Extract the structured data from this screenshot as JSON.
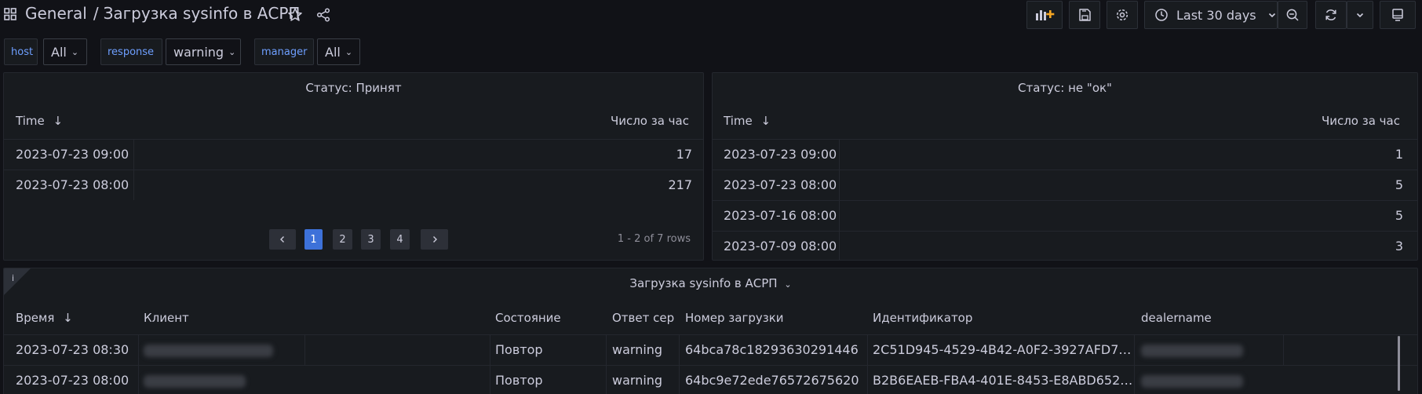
{
  "header": {
    "folder": "General",
    "separator": "/",
    "title": "Загрузка sysinfo в АСРП",
    "time_range": "Last 30 days"
  },
  "variables": [
    {
      "label": "host",
      "value": "All"
    },
    {
      "label": "response",
      "value": "warning"
    },
    {
      "label": "manager",
      "value": "All"
    }
  ],
  "panel_accepted": {
    "title": "Статус: Принят",
    "columns": [
      "Time",
      "Число за час"
    ],
    "rows": [
      [
        "2023-07-23 09:00",
        "17"
      ],
      [
        "2023-07-23 08:00",
        "217"
      ]
    ],
    "pages": [
      "1",
      "2",
      "3",
      "4"
    ],
    "active_page": "1",
    "rows_info": "1 - 2 of 7 rows"
  },
  "panel_not_ok": {
    "title": "Статус: не \"ок\"",
    "columns": [
      "Time",
      "Число за час"
    ],
    "rows": [
      [
        "2023-07-23 09:00",
        "1"
      ],
      [
        "2023-07-23 08:00",
        "5"
      ],
      [
        "2023-07-16 08:00",
        "5"
      ],
      [
        "2023-07-09 08:00",
        "3"
      ]
    ]
  },
  "panel_upload": {
    "title": "Загрузка sysinfo в АСРП",
    "columns": [
      "Время",
      "Клиент",
      "Состояние",
      "Ответ сер",
      "Номер загрузки",
      "Идентификатор",
      "dealername"
    ],
    "rows": [
      [
        "2023-07-23 08:30",
        "",
        "Повтор",
        "warning",
        "64bca78c18293630291446",
        "2C51D945-4529-4B42-A0F2-3927AFD7…",
        ""
      ],
      [
        "2023-07-23 08:00",
        "",
        "Повтор",
        "warning",
        "64bc9e72ede76572675620",
        "B2B6EAEB-FBA4-401E-8453-E8ABD652…",
        ""
      ]
    ]
  },
  "colors": {
    "background": "#111217",
    "panel": "#181b1f",
    "accent": "#3d71d9",
    "variable_label": "#6e9fff"
  }
}
